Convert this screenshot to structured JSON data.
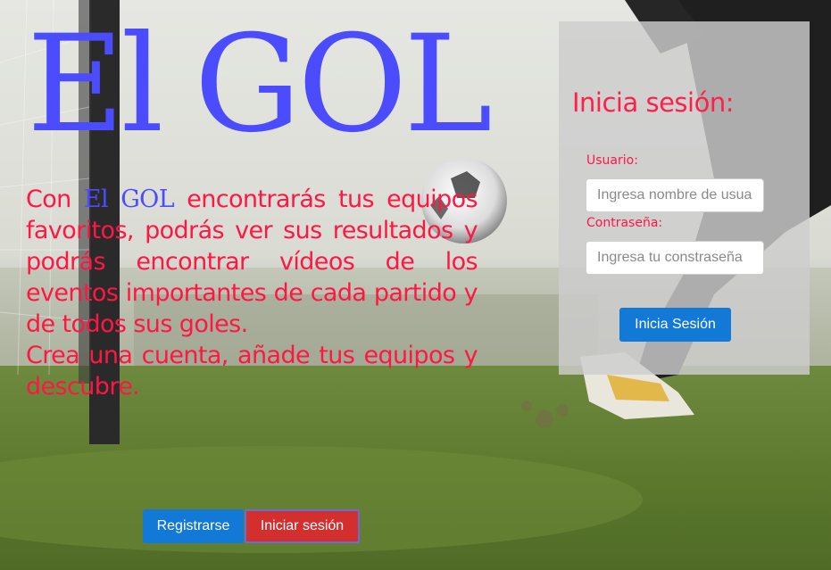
{
  "hero": {
    "title_part1": "El",
    "title_part2": "GOL",
    "paragraph1": {
      "before_brand": "Con ",
      "brand": "El GOL",
      "after_brand": " encontrarás tus equipos favoritos, podrás ver sus resultados y podrás encontrar vídeos de los eventos importantes de cada partido y de todos sus goles."
    },
    "paragraph2": "Crea una cuenta, añade tus equipos y descubre."
  },
  "login": {
    "title": "Inicia sesión:",
    "username_label": "Usuario:",
    "username_placeholder": "Ingresa nombre de usuario",
    "password_label": "Contraseña:",
    "password_placeholder": "Ingresa tu constraseña",
    "submit_label": "Inicia Sesión"
  },
  "actions": {
    "register_label": "Registrarse",
    "login_label": "Iniciar sesión"
  },
  "colors": {
    "title_blue": "#4c4cff",
    "text_red": "#ff1744",
    "button_blue": "#1279d6",
    "button_red": "#d32f2f"
  },
  "background_image": "football-field-kick-photo"
}
